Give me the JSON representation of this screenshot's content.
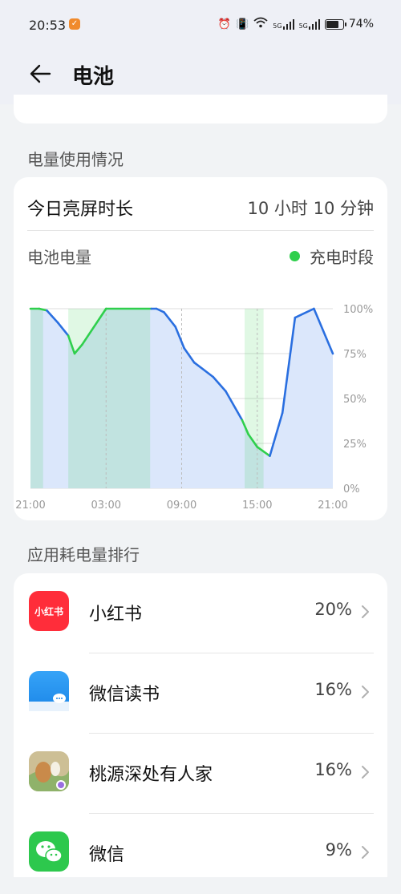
{
  "status_bar": {
    "time": "20:53",
    "signal_1_label": "5G",
    "signal_2_label": "5G",
    "battery_percent": "74%",
    "battery_level": 0.74
  },
  "header": {
    "title": "电池"
  },
  "section_usage": {
    "label": "电量使用情况"
  },
  "screen_time": {
    "label": "今日亮屏时长",
    "value": "10 小时 10 分钟"
  },
  "battery_chart": {
    "label": "电池电量",
    "legend_label": "充电时段",
    "charge_color": "#2fcf4c",
    "line_color": "#2a6fe0"
  },
  "chart_data": {
    "type": "line",
    "x_tick_labels": [
      "21:00",
      "03:00",
      "09:00",
      "15:00",
      "21:00"
    ],
    "y_tick_labels": [
      "100%",
      "75%",
      "50%",
      "25%",
      "0%"
    ],
    "ylim": [
      0,
      100
    ],
    "xlim_hours": [
      0,
      24
    ],
    "series": [
      {
        "name": "电池电量",
        "x_hours": [
          0,
          0.7,
          1.3,
          2.2,
          3.0,
          3.5,
          4.1,
          6.0,
          9.6,
          10.0,
          10.6,
          11.5,
          12.2,
          13.0,
          14.5,
          15.5,
          16.8,
          17.3,
          18.0,
          19.0,
          20.0,
          21.0,
          22.5,
          24.0
        ],
        "values": [
          100,
          100,
          99,
          92,
          85,
          75,
          80,
          100,
          100,
          100,
          98,
          90,
          78,
          70,
          62,
          54,
          38,
          30,
          23,
          18,
          42,
          95,
          100,
          75
        ]
      }
    ],
    "charging_periods_hours": [
      [
        0,
        1.0
      ],
      [
        3.0,
        9.5
      ],
      [
        17.0,
        18.5
      ]
    ]
  },
  "section_ranking": {
    "label": "应用耗电量排行"
  },
  "apps": [
    {
      "name": "小红书",
      "percent": "20%",
      "icon_text": "小红书",
      "icon": "xiaohongshu-icon"
    },
    {
      "name": "微信读书",
      "percent": "16%",
      "icon": "weread-icon"
    },
    {
      "name": "桃源深处有人家",
      "percent": "16%",
      "icon": "taoyuan-game-icon"
    },
    {
      "name": "微信",
      "percent": "9%",
      "icon": "wechat-icon"
    }
  ]
}
